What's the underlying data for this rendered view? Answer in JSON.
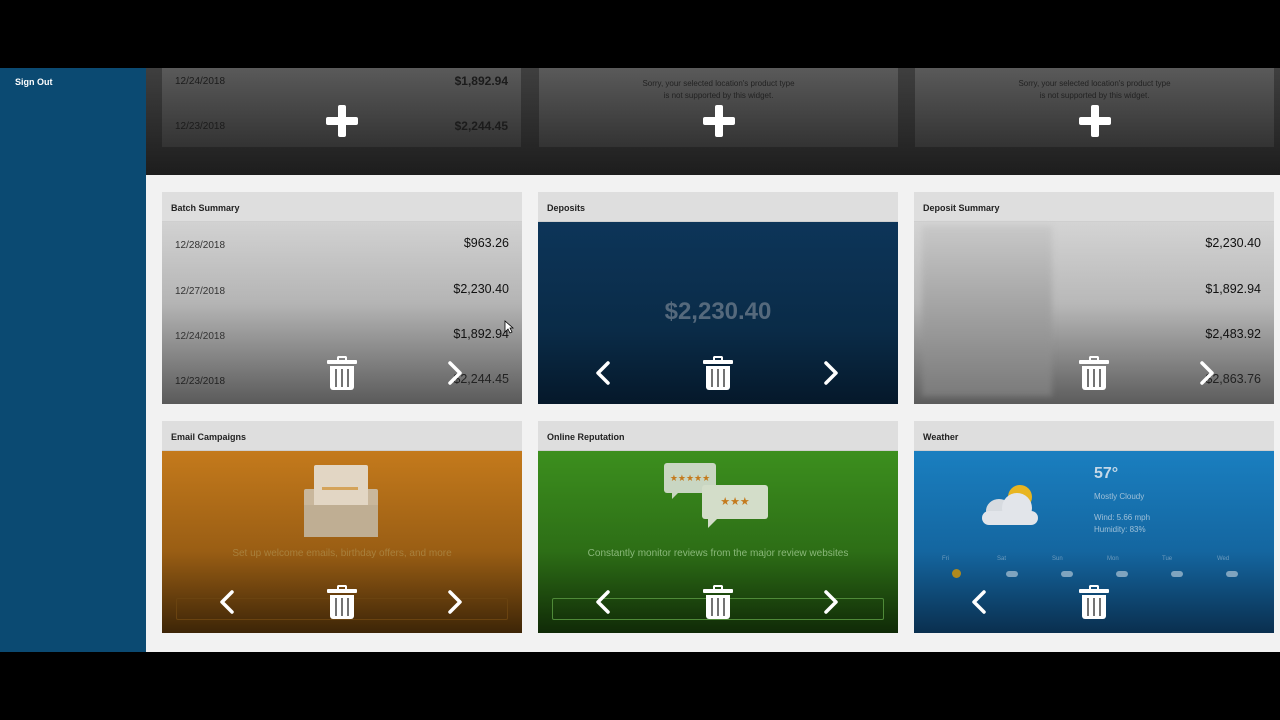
{
  "sidebar": {
    "sign_out": "Sign Out"
  },
  "top_cards": [
    {
      "rows": [
        {
          "date": "12/24/2018",
          "amount": "$1,892.94"
        },
        {
          "date": "12/23/2018",
          "amount": "$2,244.45"
        }
      ]
    },
    {
      "message_line1": "Sorry, your selected location's product type",
      "message_line2": "is not supported by this widget."
    },
    {
      "message_line1": "Sorry, your selected location's product type",
      "message_line2": "is not supported by this widget."
    }
  ],
  "batch_summary": {
    "title": "Batch Summary",
    "rows": [
      {
        "date": "12/28/2018",
        "amount": "$963.26"
      },
      {
        "date": "12/27/2018",
        "amount": "$2,230.40"
      },
      {
        "date": "12/24/2018",
        "amount": "$1,892.94"
      },
      {
        "date": "12/23/2018",
        "amount": "$2,244.45"
      }
    ]
  },
  "deposits": {
    "title": "Deposits",
    "amount": "$2,230.40"
  },
  "deposit_summary": {
    "title": "Deposit Summary",
    "amounts": [
      "$2,230.40",
      "$1,892.94",
      "$2,483.92",
      "$2,863.76"
    ]
  },
  "email_campaigns": {
    "title": "Email Campaigns",
    "description": "Set up welcome emails, birthday offers, and more"
  },
  "online_reputation": {
    "title": "Online Reputation",
    "description": "Constantly monitor reviews from the major review websites",
    "stars_top": "★★★★★",
    "stars_bottom": "★★★"
  },
  "weather": {
    "title": "Weather",
    "temperature": "57°",
    "condition": "Mostly Cloudy",
    "wind": "Wind: 5.66 mph",
    "humidity": "Humidity: 83%",
    "days": [
      "Fri",
      "Sat",
      "Sun",
      "Mon",
      "Tue",
      "Wed"
    ]
  },
  "colors": {
    "sidebar": "#0b4a72",
    "deposits": "#0b2f4c",
    "email": "#c47a1c",
    "reputation": "#3c8f1e",
    "weather": "#1473b0"
  }
}
